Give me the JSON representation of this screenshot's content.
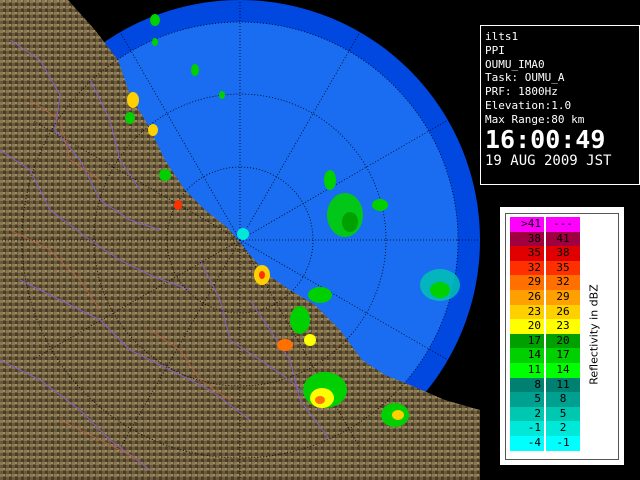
{
  "radar_name": "ilts1",
  "scan_mode": "PPI",
  "product": "OUMU_IMA0",
  "task_label": "Task: OUMU_A",
  "prf_label": "PRF: 1800Hz",
  "elevation_label": "Elevation:1.0",
  "max_range_label": "Max Range:80 km",
  "time": "16:00:49",
  "date": "19 AUG 2009 JST",
  "legend": {
    "title": "Reflectivity in dBZ",
    "rows": [
      {
        "lo": ">41",
        "hi": "---",
        "color": "#ff00ff"
      },
      {
        "lo": "38",
        "hi": "41",
        "color": "#a00040"
      },
      {
        "lo": "35",
        "hi": "38",
        "color": "#e00000"
      },
      {
        "lo": "32",
        "hi": "35",
        "color": "#ff3000"
      },
      {
        "lo": "29",
        "hi": "32",
        "color": "#ff7000"
      },
      {
        "lo": "26",
        "hi": "29",
        "color": "#ffa000"
      },
      {
        "lo": "23",
        "hi": "26",
        "color": "#ffd000"
      },
      {
        "lo": "20",
        "hi": "23",
        "color": "#ffff00"
      },
      {
        "lo": "17",
        "hi": "20",
        "color": "#00a000"
      },
      {
        "lo": "14",
        "hi": "17",
        "color": "#00d000"
      },
      {
        "lo": "11",
        "hi": "14",
        "color": "#00ff00"
      },
      {
        "lo": "8",
        "hi": "11",
        "color": "#008070"
      },
      {
        "lo": "5",
        "hi": "8",
        "color": "#00a090"
      },
      {
        "lo": "2",
        "hi": "5",
        "color": "#00c8b0"
      },
      {
        "lo": "-1",
        "hi": "2",
        "color": "#00e8d8"
      },
      {
        "lo": "-4",
        "hi": "-1",
        "color": "#00ffff"
      }
    ]
  },
  "colors": {
    "sea_outer": "#0048e0",
    "sea_inner": "#1a6cf0",
    "land": "#6a5a3c",
    "boundary": "#8060c0",
    "range_ring": "#000000"
  }
}
